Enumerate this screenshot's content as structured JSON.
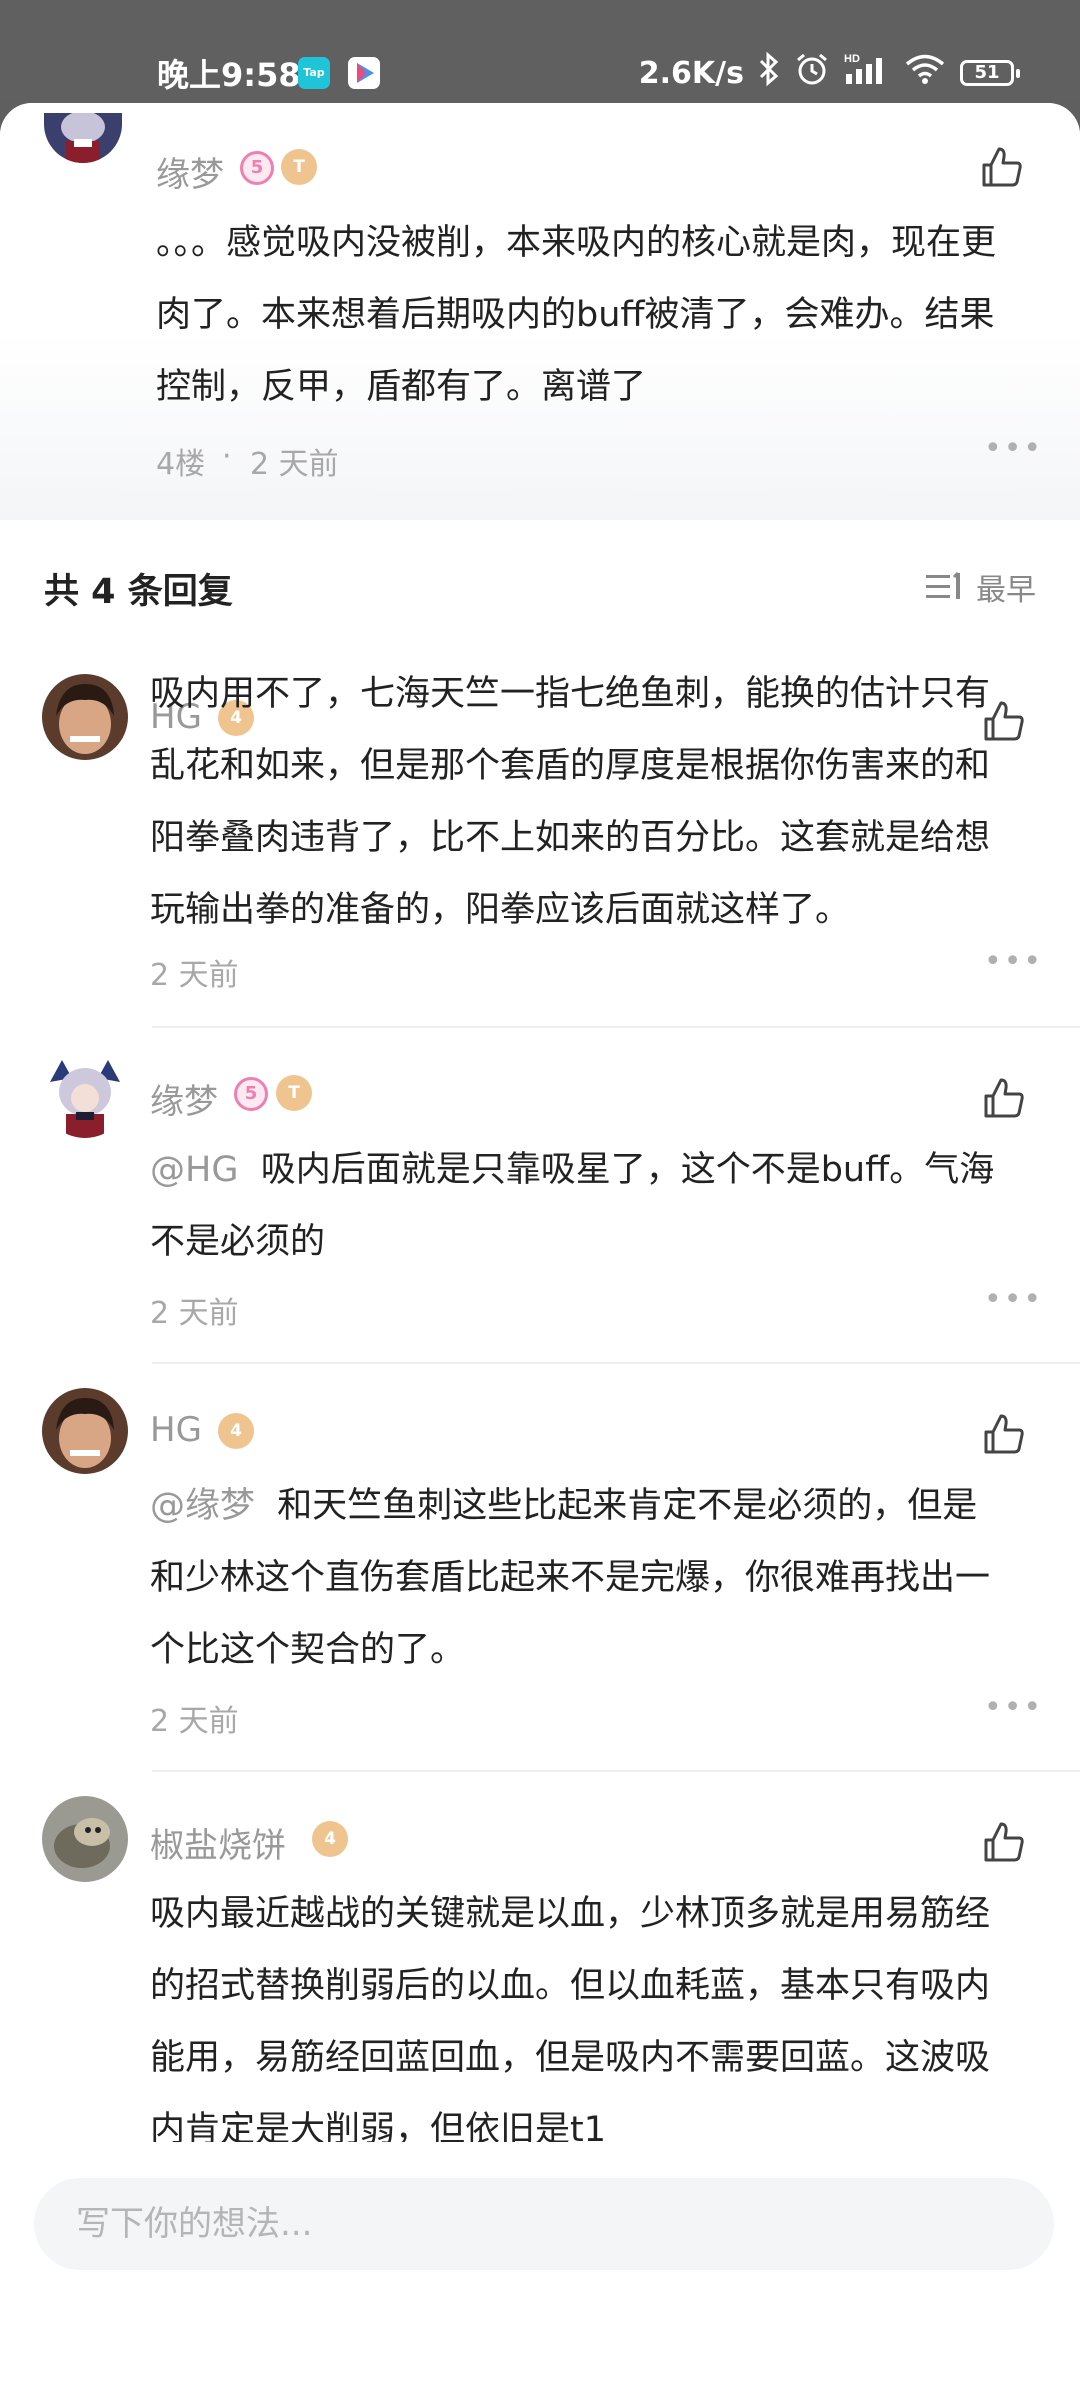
{
  "status_bar": {
    "time": "晚上9:58",
    "app_icon_1": "Tap",
    "network_speed": "2.6K/s",
    "icons": [
      "bluetooth-icon",
      "alarm-icon",
      "signal-icon",
      "wifi-icon"
    ],
    "hd_label": "HD",
    "battery": "51"
  },
  "main_comment": {
    "username": "缘梦",
    "badge_level": "5",
    "text_lines": [
      "。。。感觉吸内没被削，本来吸内的核心就是肉，现在更",
      "肉了。本来想着后期吸内的buff被清了，会难办。结果",
      "控制，反甲，盾都有了。离谱了"
    ],
    "floor": "4楼",
    "separator": "·",
    "time": "2 天前"
  },
  "replies_header": {
    "title": "共 4 条回复",
    "sort_label": "最早"
  },
  "replies": [
    {
      "username": "HG",
      "badge_level": "4",
      "mention": "",
      "text_lines": [
        "吸内用不了，七海天竺一指七绝鱼刺，能换的估计只有",
        "乱花和如来，但是那个套盾的厚度是根据你伤害来的和",
        "阳拳叠肉违背了，比不上如来的百分比。这套就是给想",
        "玩输出拳的准备的，阳拳应该后面就这样了。"
      ],
      "time": "2 天前"
    },
    {
      "username": "缘梦",
      "badge_level": "5",
      "mention": "@HG",
      "text_lines": [
        "吸内后面就是只靠吸星了，这个不是buff。气海",
        "不是必须的"
      ],
      "time": "2 天前"
    },
    {
      "username": "HG",
      "badge_level": "4",
      "mention": "@缘梦",
      "text_lines": [
        "和天竺鱼刺这些比起来肯定不是必须的，但是",
        "和少林这个直伤套盾比起来不是完爆，你很难再找出一",
        "个比这个契合的了。"
      ],
      "time": "2 天前"
    },
    {
      "username": "椒盐烧饼",
      "badge_level": "4",
      "mention": "",
      "text_lines": [
        "吸内最近越战的关键就是以血，少林顶多就是用易筋经",
        "的招式替换削弱后的以血。但以血耗蓝，基本只有吸内",
        "能用，易筋经回蓝回血，但是吸内不需要回蓝。这波吸",
        "内肯定是大削弱，但依旧是t1"
      ]
    }
  ],
  "input": {
    "placeholder": "写下你的想法..."
  },
  "colors": {
    "status_bar": "#606060",
    "meta_text": "#a8a8a8",
    "badge_gold": "#efc48e",
    "badge_pink": "#f07fb1"
  }
}
